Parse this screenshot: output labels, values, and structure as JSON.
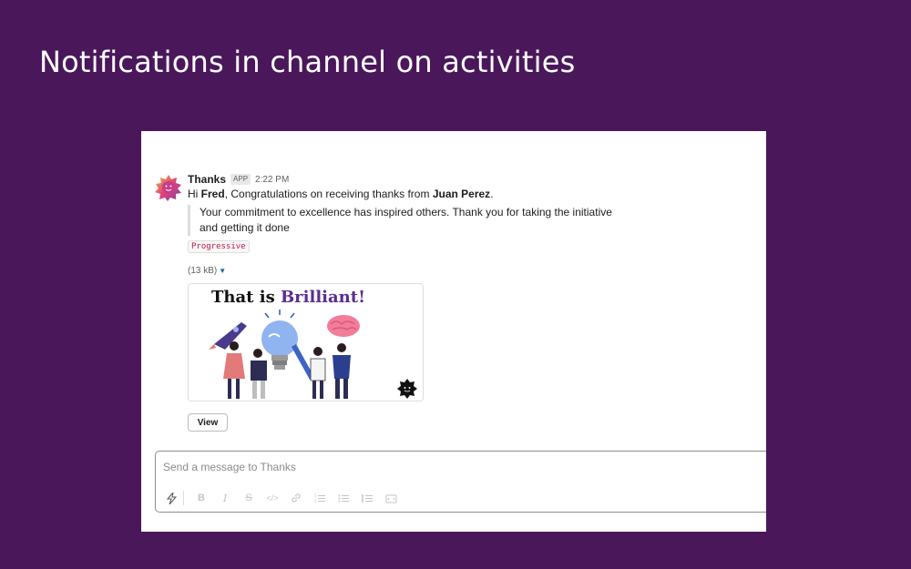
{
  "slide": {
    "title": "Notifications in channel on activities"
  },
  "message": {
    "sender": "Thanks",
    "app_badge": "APP",
    "time": "2:22 PM",
    "greeting": "Hi ",
    "recipient": "Fred",
    "middle_text": ", Congratulations on receiving thanks from ",
    "giver": "Juan Perez",
    "end_text": ".",
    "quote_line1": "Your commitment to excellence has inspired others. Thank you for taking the initiative",
    "quote_line2": "and getting it done",
    "tag": "Progressive",
    "file_size": "(13 kB)",
    "card": {
      "title_part1": "That is ",
      "title_part2": "Brilliant!"
    },
    "view_button": "View"
  },
  "composer": {
    "placeholder": "Send a message to Thanks",
    "tools": [
      "shortcuts-icon",
      "bold-icon",
      "italic-icon",
      "strikethrough-icon",
      "code-icon",
      "link-icon",
      "ordered-list-icon",
      "bulleted-list-icon",
      "blockquote-icon",
      "code-block-icon"
    ]
  },
  "colors": {
    "background": "#4a175b",
    "accent": "#5a2d8f",
    "tag": "#c01343"
  }
}
